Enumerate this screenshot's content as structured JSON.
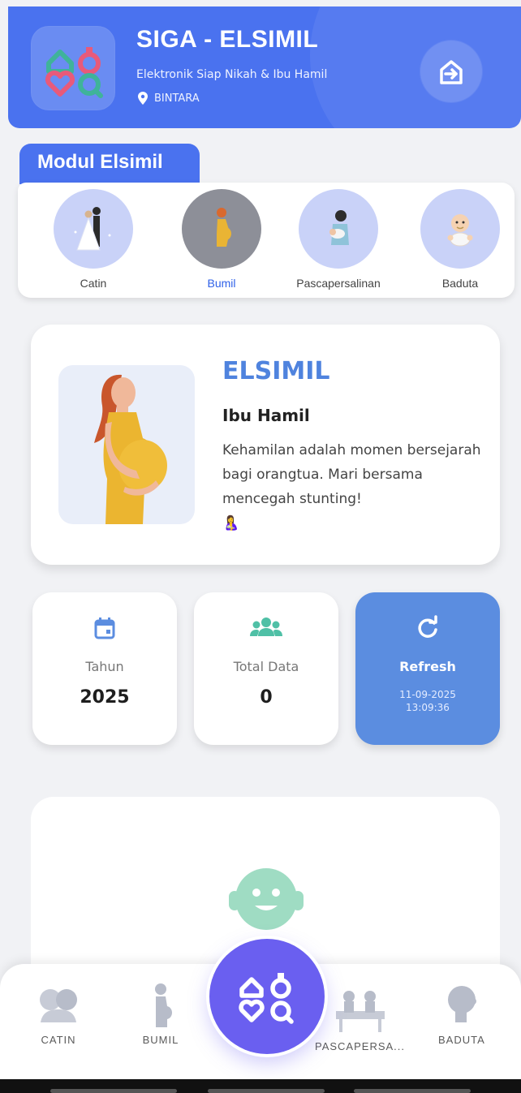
{
  "header": {
    "title": "SIGA - ELSIMIL",
    "subtitle": "Elektronik Siap Nikah & Ibu Hamil",
    "location": "BINTARA",
    "logo_icon": "siga-logo-icon",
    "logout_icon": "logout-icon",
    "color": "#4a72ef"
  },
  "modul": {
    "title": "Modul Elsimil",
    "items": [
      {
        "label": "Catin",
        "icon": "wedding-couple-icon",
        "active": false
      },
      {
        "label": "Bumil",
        "icon": "pregnant-woman-icon",
        "active": true
      },
      {
        "label": "Pascapersalinan",
        "icon": "mother-baby-icon",
        "active": false
      },
      {
        "label": "Baduta",
        "icon": "baby-icon",
        "active": false
      }
    ]
  },
  "info": {
    "title": "ELSIMIL",
    "subtitle": "Ibu Hamil",
    "description": "Kehamilan adalah momen bersejarah bagi orangtua. Mari bersama mencegah stunting!",
    "emoji": "🤱",
    "image": "pregnant-woman-illustration"
  },
  "stats": {
    "year": {
      "label": "Tahun",
      "value": "2025",
      "icon": "calendar-icon"
    },
    "total": {
      "label": "Total Data",
      "value": "0",
      "icon": "group-icon"
    },
    "refresh": {
      "label": "Refresh",
      "date": "11-09-2025",
      "time": "13:09:36",
      "icon": "refresh-icon",
      "color": "#5b8de0"
    }
  },
  "empty_state": {
    "icon": "baby-face-icon",
    "color": "#9fdcc3"
  },
  "bottom_nav": {
    "items": [
      {
        "label": "CATIN",
        "icon": "couple-icon"
      },
      {
        "label": "BUMIL",
        "icon": "pregnant-silhouette-icon"
      },
      {
        "label": "PASCAPERSA...",
        "icon": "family-icon"
      },
      {
        "label": "BADUTA",
        "icon": "child-head-icon"
      }
    ],
    "center_icon": "siga-logo-icon",
    "center_color": "#6a5ff0"
  }
}
